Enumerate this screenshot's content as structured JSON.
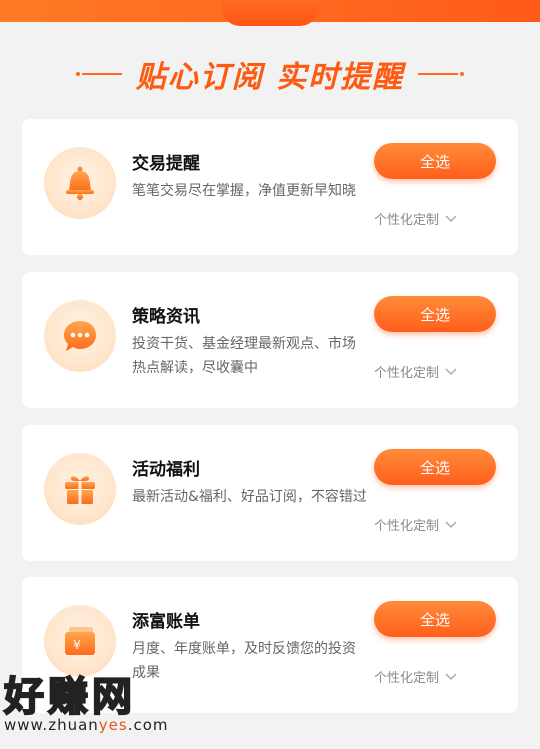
{
  "header": {
    "title": "贴心订阅  实时提醒"
  },
  "cards": [
    {
      "title": "交易提醒",
      "desc": "笔笔交易尽在掌握，净值更新早知晓",
      "button": "全选",
      "customize": "个性化定制",
      "icon": "bell-icon"
    },
    {
      "title": "策略资讯",
      "desc": "投资干货、基金经理最新观点、市场热点解读，尽收囊中",
      "button": "全选",
      "customize": "个性化定制",
      "icon": "chat-bubble-icon"
    },
    {
      "title": "活动福利",
      "desc": "最新活动&福利、好品订阅，不容错过",
      "button": "全选",
      "customize": "个性化定制",
      "icon": "gift-icon"
    },
    {
      "title": "添富账单",
      "desc": "月度、年度账单，及时反馈您的投资成果",
      "button": "全选",
      "customize": "个性化定制",
      "icon": "wallet-icon"
    }
  ],
  "watermark": {
    "brand": "好赚网",
    "url_prefix": "www.zhuan",
    "url_highlight": "yes",
    "url_suffix": ".com"
  },
  "colors": {
    "accent": "#ff5a12",
    "button_top": "#ff8c3a",
    "button_bottom": "#ff5e1b"
  }
}
